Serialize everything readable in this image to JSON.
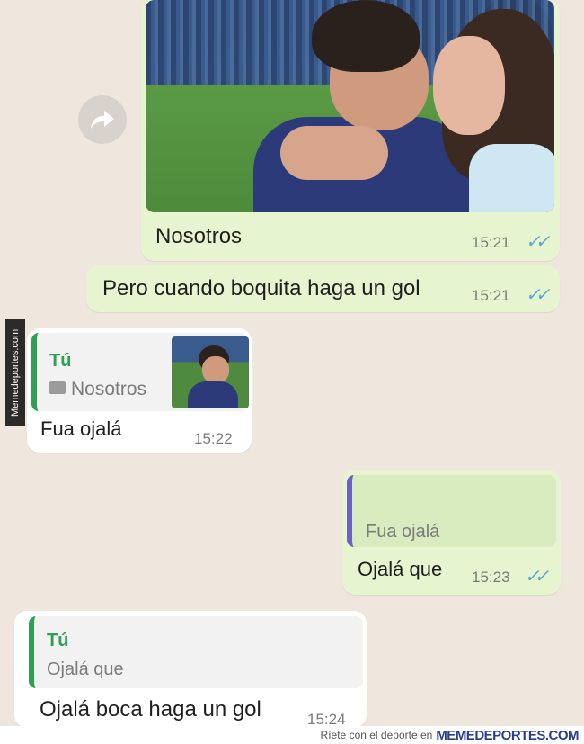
{
  "messages": {
    "m1": {
      "caption": "Nosotros",
      "time": "15:21",
      "ticks": "✓✓"
    },
    "m2": {
      "text": "Pero cuando boquita haga un gol",
      "time": "15:21",
      "ticks": "✓✓"
    },
    "m3": {
      "quote_author": "Tú",
      "quote_text": "Nosotros",
      "text": "Fua ojalá",
      "time": "15:22"
    },
    "m4": {
      "quote_text": "Fua ojalá",
      "text": "Ojalá que",
      "time": "15:23",
      "ticks": "✓✓"
    },
    "m5": {
      "quote_author": "Tú",
      "quote_text": "Ojalá que",
      "text": "Ojalá boca haga un gol",
      "time": "15:24"
    }
  },
  "watermark": {
    "side_text": "Memedeportes.com",
    "footer_text": "Ríete con el deporte en",
    "footer_brand": "MEMEDEPORTES.COM"
  },
  "colors": {
    "background": "#efe7dd",
    "outgoing_bubble": "#e6f5cf",
    "incoming_bubble": "#ffffff",
    "read_ticks": "#52a6d8"
  }
}
